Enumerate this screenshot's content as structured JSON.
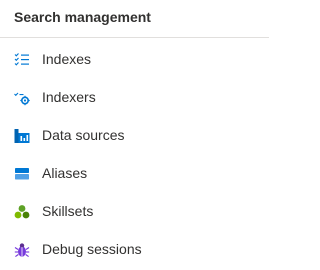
{
  "section": {
    "title": "Search management"
  },
  "nav": {
    "items": [
      {
        "id": "indexes",
        "label": "Indexes",
        "icon": "checklist-icon",
        "color": "#0078d4"
      },
      {
        "id": "indexers",
        "label": "Indexers",
        "icon": "indexer-gear-icon",
        "color": "#0078d4"
      },
      {
        "id": "data-sources",
        "label": "Data sources",
        "icon": "data-sources-icon",
        "color": "#0063b1"
      },
      {
        "id": "aliases",
        "label": "Aliases",
        "icon": "aliases-icon",
        "color": "#0078d4"
      },
      {
        "id": "skillsets",
        "label": "Skillsets",
        "icon": "skillsets-icon",
        "color": "#5ea226"
      },
      {
        "id": "debug-sessions",
        "label": "Debug sessions",
        "icon": "bug-icon",
        "color": "#773adc"
      }
    ]
  }
}
